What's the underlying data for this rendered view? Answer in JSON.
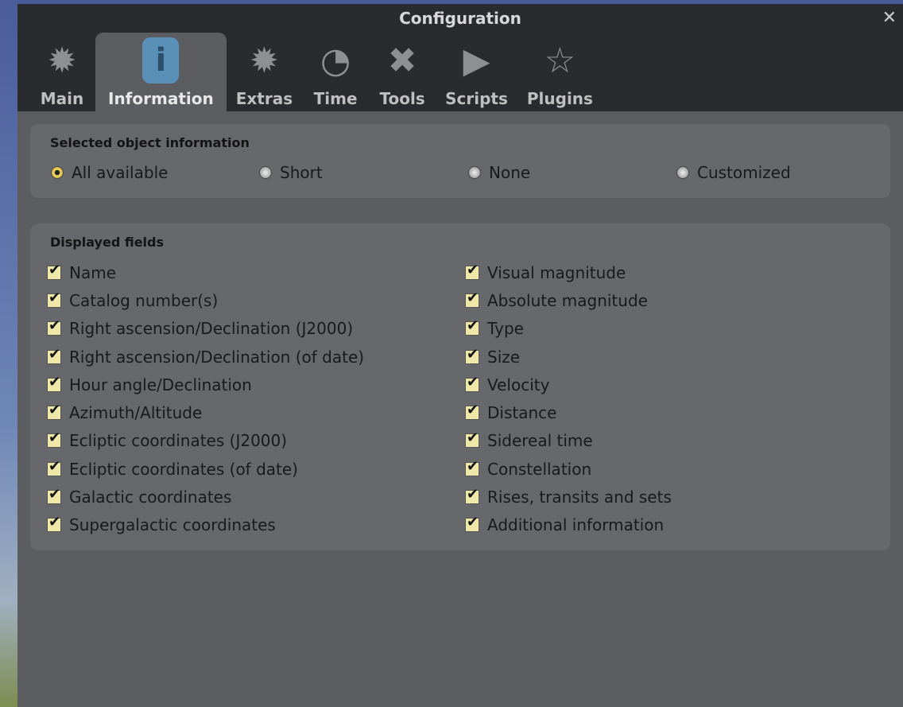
{
  "window": {
    "title": "Configuration",
    "close_icon": "close-icon"
  },
  "tabs": [
    {
      "label": "Main",
      "icon": "gear-star-icon"
    },
    {
      "label": "Information",
      "icon": "info-icon",
      "active": true
    },
    {
      "label": "Extras",
      "icon": "extras-icon"
    },
    {
      "label": "Time",
      "icon": "clock-icon"
    },
    {
      "label": "Tools",
      "icon": "tools-icon"
    },
    {
      "label": "Scripts",
      "icon": "play-icon"
    },
    {
      "label": "Plugins",
      "icon": "plugin-icon"
    }
  ],
  "selected_info": {
    "title": "Selected object information",
    "options": [
      "All available",
      "Short",
      "None",
      "Customized"
    ],
    "selected": "All available"
  },
  "fields": {
    "title": "Displayed fields",
    "left": [
      "Name",
      "Catalog number(s)",
      "Right ascension/Declination (J2000)",
      "Right ascension/Declination (of date)",
      "Hour angle/Declination",
      "Azimuth/Altitude",
      "Ecliptic coordinates (J2000)",
      "Ecliptic coordinates (of date)",
      "Galactic coordinates",
      "Supergalactic coordinates"
    ],
    "right": [
      "Visual magnitude",
      "Absolute magnitude",
      "Type",
      "Size",
      "Velocity",
      "Distance",
      "Sidereal time",
      "Constellation",
      "Rises, transits and sets",
      "Additional information"
    ]
  }
}
